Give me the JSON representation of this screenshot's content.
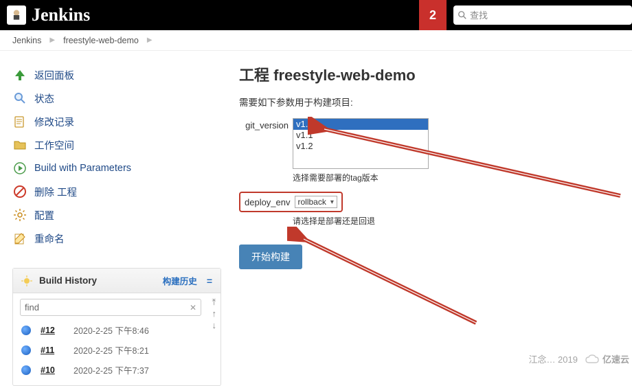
{
  "header": {
    "brand": "Jenkins",
    "notif_count": "2",
    "search_placeholder": "查找"
  },
  "breadcrumb": {
    "items": [
      "Jenkins",
      "freestyle-web-demo"
    ]
  },
  "sidebar": {
    "items": [
      {
        "label": "返回面板"
      },
      {
        "label": "状态"
      },
      {
        "label": "修改记录"
      },
      {
        "label": "工作空间"
      },
      {
        "label": "Build with Parameters"
      },
      {
        "label": "删除 工程"
      },
      {
        "label": "配置"
      },
      {
        "label": "重命名"
      }
    ],
    "history": {
      "title": "Build History",
      "trend_label": "构建历史",
      "collapse": "=",
      "search_value": "find",
      "builds": [
        {
          "num": "#12",
          "date": "2020-2-25 下午8:46"
        },
        {
          "num": "#11",
          "date": "2020-2-25 下午8:21"
        },
        {
          "num": "#10",
          "date": "2020-2-25 下午7:37"
        }
      ]
    }
  },
  "main": {
    "title": "工程 freestyle-web-demo",
    "desc": "需要如下参数用于构建项目:",
    "git_version": {
      "label": "git_version",
      "options": [
        "v1.3",
        "v1.1",
        "v1.2"
      ],
      "selected": "v1.3",
      "help": "选择需要部署的tag版本"
    },
    "deploy_env": {
      "label": "deploy_env",
      "selected": "rollback",
      "help": "请选择是部署还是回退"
    },
    "build_button": "开始构建"
  },
  "watermark": {
    "text1": "江念… 2019",
    "text2": "亿速云"
  }
}
